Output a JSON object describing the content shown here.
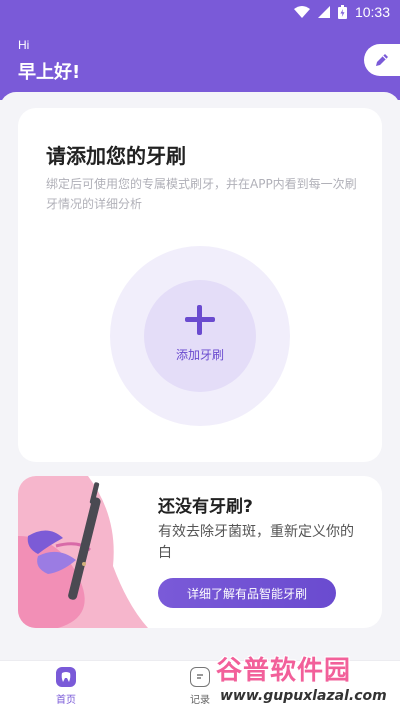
{
  "status_bar": {
    "time": "10:33",
    "icons": [
      "wifi-icon",
      "signal-icon",
      "battery-icon"
    ]
  },
  "header": {
    "hi": "Hi",
    "greeting": "早上好!",
    "edit_icon": "pencil-icon"
  },
  "add_card": {
    "title": "请添加您的牙刷",
    "description": "绑定后可使用您的专属模式刷牙，并在APP内看到每一次刷牙情况的详细分析",
    "add_label": "添加牙刷"
  },
  "promo_card": {
    "title": "还没有牙刷?",
    "description": "有效去除牙菌斑，重新定义你的白",
    "button_label": "详细了解有品智能牙刷"
  },
  "tabbar": {
    "tabs": [
      {
        "label": "首页",
        "icon": "tooth-icon",
        "active": true
      },
      {
        "label": "记录",
        "icon": "record-icon",
        "active": false
      }
    ]
  },
  "watermark": {
    "text": "谷普软件园",
    "url": "www.gupuxlazal.com"
  },
  "colors": {
    "primary": "#7a5ad8",
    "accent": "#6a4bcf",
    "background": "#f4f4f8"
  }
}
